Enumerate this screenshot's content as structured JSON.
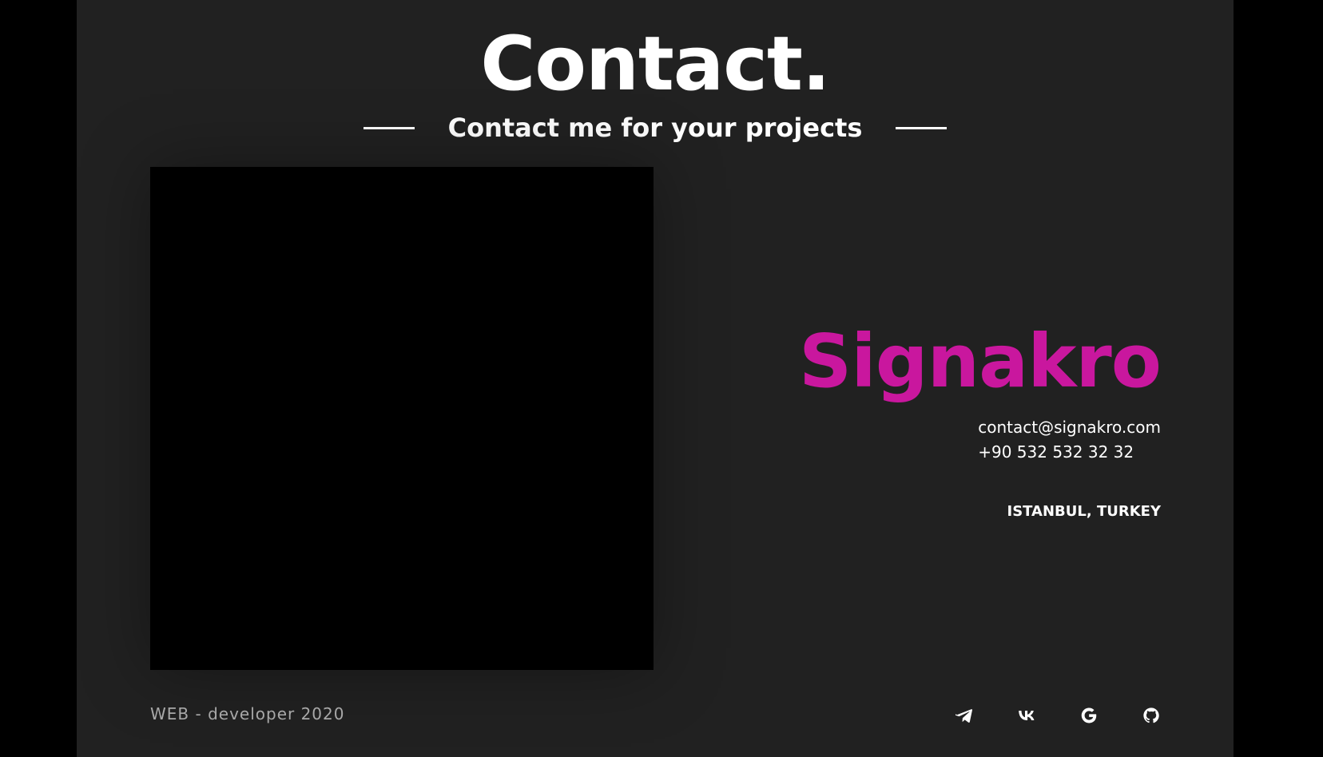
{
  "header": {
    "title": "Contact.",
    "subtitle": "Contact me for your projects"
  },
  "profile": {
    "name": "Signakro",
    "email": "contact@signakro.com",
    "phone": "+90 532 532 32 32",
    "location": "ISTANBUL, TURKEY"
  },
  "footer": {
    "text": "WEB - developer 2020",
    "social": [
      {
        "name": "telegram",
        "icon": "telegram-icon"
      },
      {
        "name": "vk",
        "icon": "vk-icon"
      },
      {
        "name": "google",
        "icon": "google-icon"
      },
      {
        "name": "github",
        "icon": "github-icon"
      }
    ]
  },
  "colors": {
    "background": "#212121",
    "outer": "#000000",
    "accent": "#c9179e",
    "text": "#ffffff",
    "muted": "#a8a8a8"
  }
}
